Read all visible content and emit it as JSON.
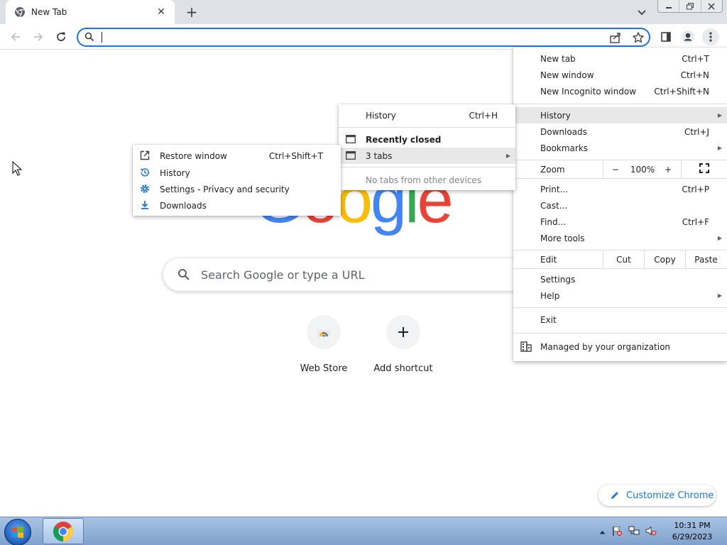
{
  "tab": {
    "title": "New Tab",
    "close": "✕"
  },
  "newtab_plus": "+",
  "omnibox": {
    "value": ""
  },
  "ntp": {
    "search_placeholder": "Search Google or type a URL",
    "shortcuts": [
      {
        "label": "Web Store"
      },
      {
        "label": "Add shortcut"
      }
    ],
    "customize_label": "Customize Chrome"
  },
  "main_menu": {
    "items": [
      {
        "label": "New tab",
        "shortcut": "Ctrl+T"
      },
      {
        "label": "New window",
        "shortcut": "Ctrl+N"
      },
      {
        "label": "New Incognito window",
        "shortcut": "Ctrl+Shift+N"
      },
      {
        "label": "History",
        "shortcut": ""
      },
      {
        "label": "Downloads",
        "shortcut": "Ctrl+J"
      },
      {
        "label": "Bookmarks",
        "shortcut": ""
      },
      {
        "label": "Print...",
        "shortcut": "Ctrl+P"
      },
      {
        "label": "Cast...",
        "shortcut": ""
      },
      {
        "label": "Find...",
        "shortcut": "Ctrl+F"
      },
      {
        "label": "More tools",
        "shortcut": ""
      },
      {
        "label": "Settings",
        "shortcut": ""
      },
      {
        "label": "Help",
        "shortcut": ""
      },
      {
        "label": "Exit",
        "shortcut": ""
      }
    ],
    "zoom": {
      "label": "Zoom",
      "minus": "−",
      "value": "100%",
      "plus": "+"
    },
    "edit": {
      "label": "Edit",
      "cut": "Cut",
      "copy": "Copy",
      "paste": "Paste"
    },
    "managed": "Managed by your organization"
  },
  "history_menu": {
    "history": {
      "label": "History",
      "shortcut": "Ctrl+H"
    },
    "recently_closed": "Recently closed",
    "tabs_entry": "3 tabs",
    "no_tabs": "No tabs from other devices"
  },
  "recent_submenu": {
    "items": [
      {
        "label": "Restore window",
        "shortcut": "Ctrl+Shift+T"
      },
      {
        "label": "History",
        "shortcut": ""
      },
      {
        "label": "Settings - Privacy and security",
        "shortcut": ""
      },
      {
        "label": "Downloads",
        "shortcut": ""
      }
    ]
  },
  "taskbar": {
    "time": "10:31 PM",
    "date": "6/29/2023"
  },
  "colors": {
    "accent": "#1a73e8",
    "google_blue": "#4285f4",
    "google_red": "#ea4335",
    "google_yellow": "#fbbc05",
    "google_green": "#34a853"
  }
}
